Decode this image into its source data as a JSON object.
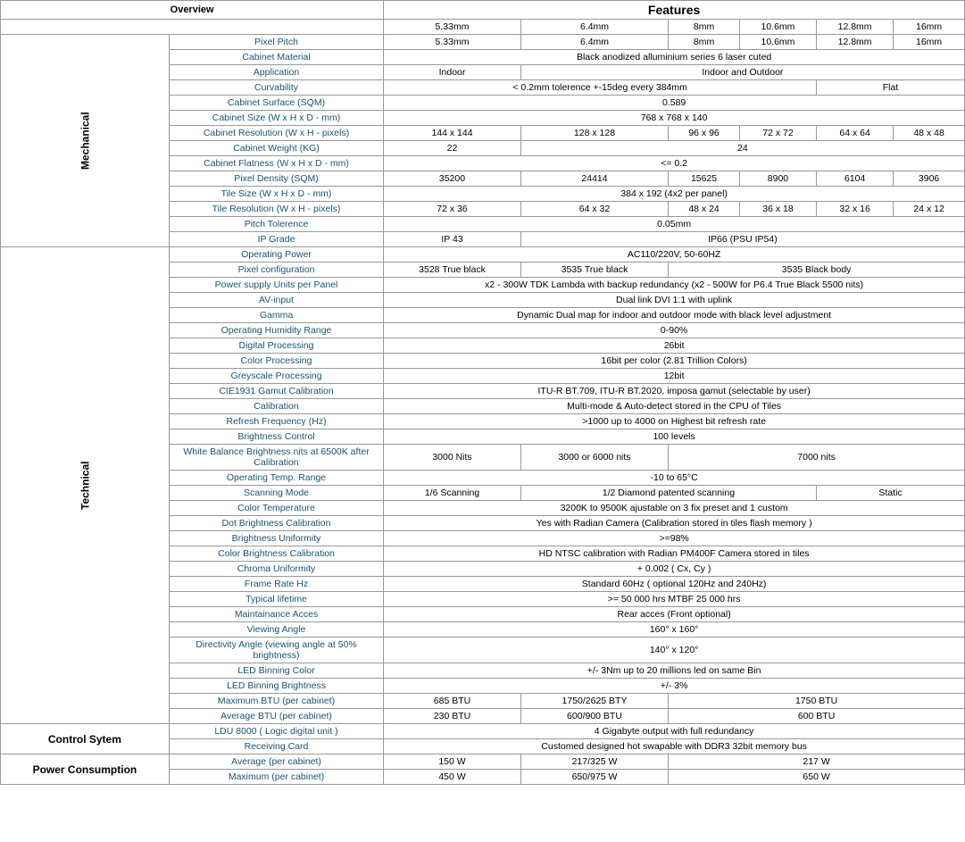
{
  "title": "Features",
  "overview_label": "Overview",
  "sections": {
    "mechanical": "Mechanical",
    "technical": "Technical",
    "control": "Control Sytem",
    "power": "Power Consumption"
  },
  "columns": [
    "5.33mm",
    "6.4mm",
    "8mm",
    "10.6mm",
    "12.8mm",
    "16mm"
  ],
  "rows": {
    "mechanical": [
      {
        "label": "Pixel Pitch",
        "values": [
          "5.33mm",
          "6.4mm",
          "8mm",
          "10.6mm",
          "12.8mm",
          "16mm"
        ],
        "mode": "separate"
      },
      {
        "label": "Cabinet Material",
        "values": [
          "Black anodized alluminium series 6 laser cuted"
        ],
        "mode": "span6"
      },
      {
        "label": "Application",
        "values": [
          "Indoor",
          "Indoor and Outdoor"
        ],
        "mode": "span1_span5"
      },
      {
        "label": "Curvability",
        "values": [
          "< 0.2mm tolerence +-15deg every 384mm",
          "Flat"
        ],
        "mode": "span4_span2"
      },
      {
        "label": "Cabinet Surface  (SQM)",
        "values": [
          "0.589"
        ],
        "mode": "span6"
      },
      {
        "label": "Cabinet Size (W x H x D - mm)",
        "values": [
          "768 x 768 x 140"
        ],
        "mode": "span6"
      },
      {
        "label": "Cabinet Resolution (W x H - pixels)",
        "values": [
          "144 x 144",
          "128 x 128",
          "96 x 96",
          "72 x 72",
          "64 x 64",
          "48 x 48"
        ],
        "mode": "separate"
      },
      {
        "label": "Cabinet Weight (KG)",
        "values": [
          "22",
          "24"
        ],
        "mode": "span1_span5"
      },
      {
        "label": "Cabinet Flatness (W x H x D - mm)",
        "values": [
          "<= 0.2"
        ],
        "mode": "span6"
      },
      {
        "label": "Pixel Density  (SQM)",
        "values": [
          "35200",
          "24414",
          "15625",
          "8900",
          "6104",
          "3906"
        ],
        "mode": "separate"
      },
      {
        "label": "Tile Size (W x H x D - mm)",
        "values": [
          "384 x 192 (4x2 per panel)"
        ],
        "mode": "span6"
      },
      {
        "label": "Tile Resolution (W x H - pixels)",
        "values": [
          "72 x 36",
          "64 x 32",
          "48 x 24",
          "36 x 18",
          "32 x 16",
          "24 x 12"
        ],
        "mode": "separate"
      },
      {
        "label": "Pitch Tolerence",
        "values": [
          "0.05mm"
        ],
        "mode": "span6"
      },
      {
        "label": "IP Grade",
        "values": [
          "IP 43",
          "IP66 (PSU IP54)"
        ],
        "mode": "span1_span5"
      }
    ],
    "technical": [
      {
        "label": "Operating Power",
        "values": [
          "AC110/220V, 50-60HZ"
        ],
        "mode": "span6"
      },
      {
        "label": "Pixel configuration",
        "values": [
          "3528 True black",
          "3535 True black",
          "3535 Black body"
        ],
        "mode": "span1_span1_span4"
      },
      {
        "label": "Power supply Units per Panel",
        "values": [
          "x2 - 300W TDK Lambda with backup redundancy (x2 - 500W for P6.4 True Black 5500 nits)"
        ],
        "mode": "span6"
      },
      {
        "label": "AV-input",
        "values": [
          "Dual link DVI 1:1 with uplink"
        ],
        "mode": "span6"
      },
      {
        "label": "Gamma",
        "values": [
          "Dynamic Dual map for indoor and outdoor mode with black level adjustment"
        ],
        "mode": "span6"
      },
      {
        "label": "Operating Humidity Range",
        "values": [
          "0-90%"
        ],
        "mode": "span6"
      },
      {
        "label": "Digital Processing",
        "values": [
          "26bit"
        ],
        "mode": "span6"
      },
      {
        "label": "Color Processing",
        "values": [
          "16bit per color (2.81 Trillion Colors)"
        ],
        "mode": "span6"
      },
      {
        "label": "Greyscale Processing",
        "values": [
          "12bit"
        ],
        "mode": "span6"
      },
      {
        "label": "CIE1931 Gamut Calibration",
        "values": [
          "ITU-R BT.709, ITU-R BT.2020, imposa gamut (selectable by user)"
        ],
        "mode": "span6"
      },
      {
        "label": "Calibration",
        "values": [
          "Multi-mode & Auto-detect stored in the CPU of Tiles"
        ],
        "mode": "span6"
      },
      {
        "label": "Refresh Frequency (Hz)",
        "values": [
          ">1000 up to 4000 on Highest bit refresh rate"
        ],
        "mode": "span6"
      },
      {
        "label": "Brightness Control",
        "values": [
          "100 levels"
        ],
        "mode": "span6"
      },
      {
        "label": "White Balance Brightness nits at 6500K after Calibration",
        "values": [
          "3000 Nits",
          "3000 or 6000 nits",
          "7000 nits"
        ],
        "mode": "span1_span1_span4"
      },
      {
        "label": "Operating Temp. Range",
        "values": [
          "-10 to 65°C"
        ],
        "mode": "span6"
      },
      {
        "label": "Scanning Mode",
        "values": [
          "1/6 Scanning",
          "1/2 Diamond patented scanning",
          "Static"
        ],
        "mode": "span1_span3_span2"
      },
      {
        "label": "Color Temperature",
        "values": [
          "3200K to 9500K ajustable on 3 fix preset and 1 custom"
        ],
        "mode": "span6"
      },
      {
        "label": "Dot Brightness Calibration",
        "values": [
          "Yes with Radian Camera         (Calibration stored  in tiles flash memory )"
        ],
        "mode": "span6"
      },
      {
        "label": "Brightness Uniformity",
        "values": [
          ">=98%"
        ],
        "mode": "span6"
      },
      {
        "label": "Color Brightness Calibration",
        "values": [
          "HD NTSC calibration with Radian PM400F Camera stored in tiles"
        ],
        "mode": "span6"
      },
      {
        "label": "Chroma Uniformity",
        "values": [
          "+  0.002  ( Cx, Cy )"
        ],
        "mode": "span6"
      },
      {
        "label": "Frame Rate Hz",
        "values": [
          "Standard 60Hz ( optional 120Hz and 240Hz)"
        ],
        "mode": "span6"
      },
      {
        "label": "Typical lifetime",
        "values": [
          ">= 50 000 hrs  MTBF 25 000 hrs"
        ],
        "mode": "span6"
      },
      {
        "label": "Maintainance Acces",
        "values": [
          "Rear acces (Front optional)"
        ],
        "mode": "span6"
      },
      {
        "label": "Viewing Angle",
        "values": [
          "160° x 160°"
        ],
        "mode": "span6"
      },
      {
        "label": "Directivity Angle (viewing angle at 50% brightness)",
        "values": [
          "140° x 120°"
        ],
        "mode": "span6"
      },
      {
        "label": "LED Binning Color",
        "values": [
          "+/- 3Nm  up to 20 millions led on same Bin"
        ],
        "mode": "span6"
      },
      {
        "label": "LED Binning Brightness",
        "values": [
          "+/- 3%"
        ],
        "mode": "span6"
      },
      {
        "label": "Maximum BTU (per cabinet)",
        "values": [
          "685 BTU",
          "1750/2625 BTY",
          "1750 BTU"
        ],
        "mode": "span1_span1_span4"
      },
      {
        "label": "Average BTU (per cabinet)",
        "values": [
          "230 BTU",
          "600/900 BTU",
          "600 BTU"
        ],
        "mode": "span1_span1_span4"
      }
    ],
    "control": [
      {
        "label": "LDU 8000 ( Logic digital unit )",
        "values": [
          "4 Gigabyte output with full redundancy"
        ],
        "mode": "span6"
      },
      {
        "label": "Receiving Card",
        "values": [
          "Customed designed hot swapable with DDR3 32bit memory bus"
        ],
        "mode": "span6"
      }
    ],
    "power": [
      {
        "label": "Average (per cabinet)",
        "values": [
          "150 W",
          "217/325 W",
          "217 W"
        ],
        "mode": "span1_span1_span4"
      },
      {
        "label": "Maximum (per cabinet)",
        "values": [
          "450 W",
          "650/975 W",
          "650 W"
        ],
        "mode": "span1_span1_span4"
      }
    ]
  }
}
